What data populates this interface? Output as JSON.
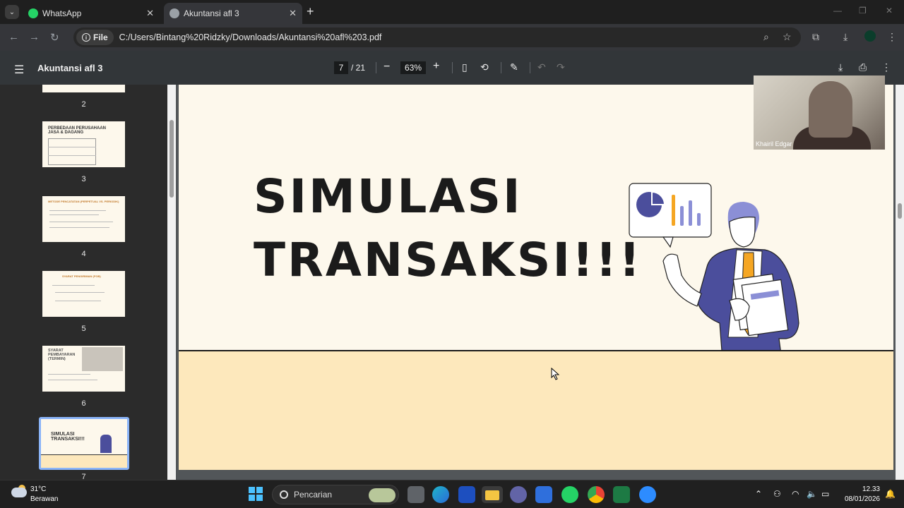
{
  "tabs": [
    {
      "title": "WhatsApp",
      "icon": "whatsapp-icon",
      "active": false
    },
    {
      "title": "Akuntansi afl 3",
      "icon": "globe-icon",
      "active": true
    }
  ],
  "address": {
    "chip_label": "File",
    "url": "C:/Users/Bintang%20Ridzky/Downloads/Akuntansi%20afl%203.pdf"
  },
  "pdf_toolbar": {
    "title": "Akuntansi afl 3",
    "page_current": "7",
    "page_total": "/ 21",
    "zoom": "63%"
  },
  "thumbnails": [
    {
      "number": "2"
    },
    {
      "number": "3",
      "title": "PERBEDAAN PERUSAHAAN JASA & DAGANG"
    },
    {
      "number": "4",
      "title": "METODE PENCATATAN (PERPETUAL VS. PERIODIK)"
    },
    {
      "number": "5",
      "title": "SYARAT PENGIRIMAN (FOB)"
    },
    {
      "number": "6",
      "title": "SYARAT PEMBAYARAN (TERMIN)"
    },
    {
      "number": "7",
      "title": "SIMULASI TRANSAKSI!!!",
      "selected": true
    }
  ],
  "slide": {
    "line1": "SIMULASI",
    "line2": "TRANSAKSI!!!"
  },
  "video": {
    "participant": "Khairil Edgar"
  },
  "taskbar": {
    "temperature": "31°C",
    "condition": "Berawan",
    "search_placeholder": "Pencarian",
    "time": "12.33",
    "date": "08/01/2026"
  },
  "colors": {
    "slide_bg": "#fdf8ec",
    "slide_band": "#fde8bc",
    "accent_purple": "#4b4e9c",
    "accent_orange": "#f5a623"
  }
}
